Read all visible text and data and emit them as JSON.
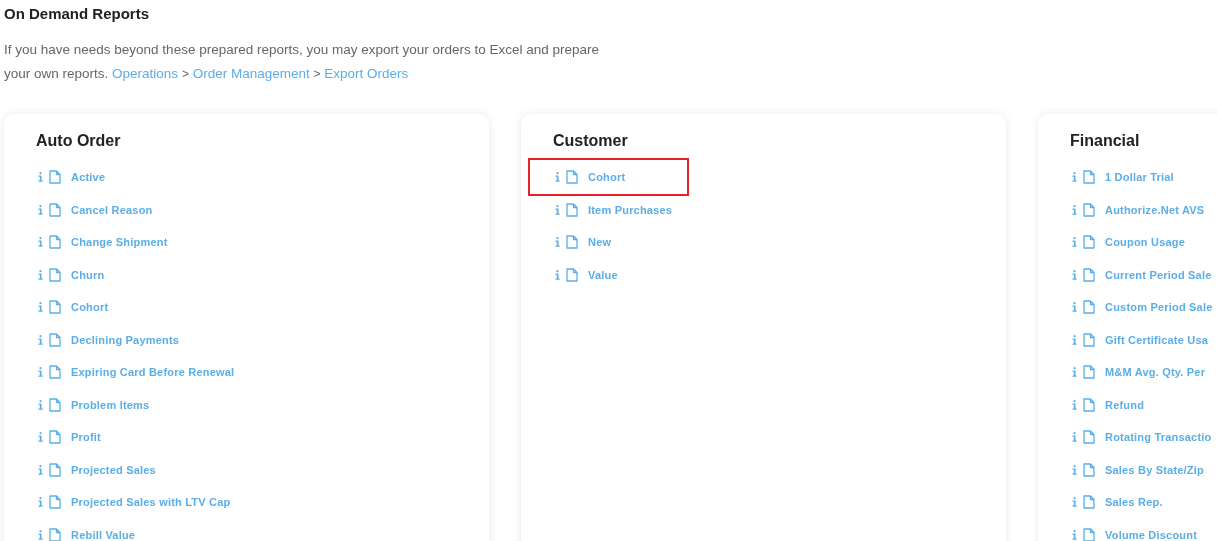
{
  "title": "On Demand Reports",
  "intro": {
    "text": "If you have needs beyond these prepared reports, you may export your orders to Excel and prepare your own reports.",
    "breadcrumb": [
      {
        "label": "Operations"
      },
      {
        "label": "Order Management"
      },
      {
        "label": "Export Orders"
      }
    ],
    "separator": ">"
  },
  "cards": [
    {
      "title": "Auto Order",
      "items": [
        {
          "label": "Active",
          "highlighted": false
        },
        {
          "label": "Cancel Reason",
          "highlighted": false
        },
        {
          "label": "Change Shipment",
          "highlighted": false
        },
        {
          "label": "Churn",
          "highlighted": false
        },
        {
          "label": "Cohort",
          "highlighted": false
        },
        {
          "label": "Declining Payments",
          "highlighted": false
        },
        {
          "label": "Expiring Card Before Renewal",
          "highlighted": false
        },
        {
          "label": "Problem Items",
          "highlighted": false
        },
        {
          "label": "Profit",
          "highlighted": false
        },
        {
          "label": "Projected Sales",
          "highlighted": false
        },
        {
          "label": "Projected Sales with LTV Cap",
          "highlighted": false
        },
        {
          "label": "Rebill Value",
          "highlighted": false
        }
      ]
    },
    {
      "title": "Customer",
      "items": [
        {
          "label": "Cohort",
          "highlighted": true
        },
        {
          "label": "Item Purchases",
          "highlighted": false
        },
        {
          "label": "New",
          "highlighted": false
        },
        {
          "label": "Value",
          "highlighted": false
        }
      ]
    },
    {
      "title": "Financial",
      "items": [
        {
          "label": "1 Dollar Trial",
          "highlighted": false
        },
        {
          "label": "Authorize.Net AVS",
          "highlighted": false
        },
        {
          "label": "Coupon Usage",
          "highlighted": false
        },
        {
          "label": "Current Period Sale",
          "highlighted": false
        },
        {
          "label": "Custom Period Sale",
          "highlighted": false
        },
        {
          "label": "Gift Certificate Usa",
          "highlighted": false
        },
        {
          "label": "M&M Avg. Qty. Per",
          "highlighted": false
        },
        {
          "label": "Refund",
          "highlighted": false
        },
        {
          "label": "Rotating Transactio",
          "highlighted": false
        },
        {
          "label": "Sales By State/Zip",
          "highlighted": false
        },
        {
          "label": "Sales Rep.",
          "highlighted": false
        },
        {
          "label": "Volume Discount",
          "highlighted": false
        }
      ]
    }
  ]
}
